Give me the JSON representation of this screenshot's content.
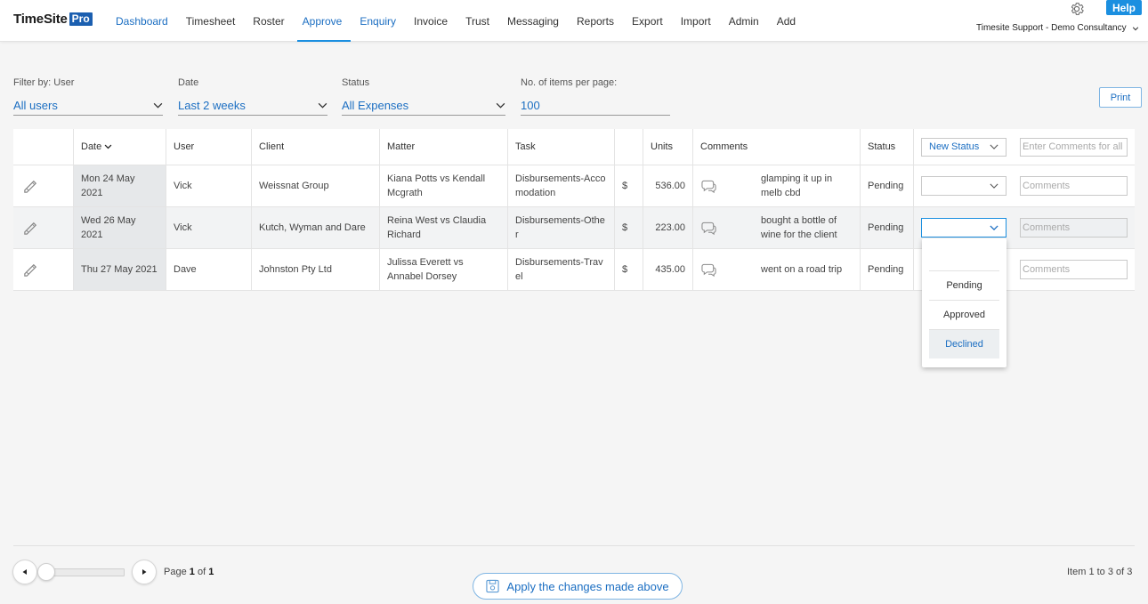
{
  "app": {
    "logo_main": "TimeSite",
    "logo_pro": "Pro",
    "help_label": "Help",
    "account_label": "Timesite Support - Demo Consultancy"
  },
  "nav": {
    "items": [
      {
        "label": "Dashboard"
      },
      {
        "label": "Timesheet"
      },
      {
        "label": "Roster"
      },
      {
        "label": "Approve"
      },
      {
        "label": "Enquiry"
      },
      {
        "label": "Invoice"
      },
      {
        "label": "Trust"
      },
      {
        "label": "Messaging"
      },
      {
        "label": "Reports"
      },
      {
        "label": "Export"
      },
      {
        "label": "Import"
      },
      {
        "label": "Admin"
      },
      {
        "label": "Add"
      }
    ],
    "active": "Approve"
  },
  "filters": {
    "user": {
      "label": "Filter by: User",
      "value": "All users"
    },
    "date": {
      "label": "Date",
      "value": "Last 2 weeks"
    },
    "status": {
      "label": "Status",
      "value": "All Expenses"
    },
    "per_page": {
      "label": "No. of items per page:",
      "value": "100"
    },
    "print_label": "Print"
  },
  "table": {
    "headers": {
      "date": "Date",
      "user": "User",
      "client": "Client",
      "matter": "Matter",
      "task": "Task",
      "units": "Units",
      "comments": "Comments",
      "status": "Status",
      "new_status": "New Status",
      "comments_all_placeholder": "Enter Comments for all"
    },
    "rows": [
      {
        "date": "Mon 24 May 2021",
        "user": "Vick",
        "client": "Weissnat Group",
        "matter": "Kiana Potts vs Kendall Mcgrath",
        "task": "Disbursements-Accomodation",
        "currency": "$",
        "units": "536.00",
        "comment": "glamping it up in melb cbd",
        "status": "Pending",
        "comment_placeholder": "Comments"
      },
      {
        "date": "Wed 26 May 2021",
        "user": "Vick",
        "client": "Kutch, Wyman and Dare",
        "matter": "Reina West vs Claudia Richard",
        "task": "Disbursements-Other",
        "currency": "$",
        "units": "223.00",
        "comment": "bought a bottle of wine for the client",
        "status": "Pending",
        "comment_placeholder": "Comments"
      },
      {
        "date": "Thu 27 May 2021",
        "user": "Dave",
        "client": "Johnston Pty Ltd",
        "matter": "Julissa Everett vs Annabel Dorsey",
        "task": "Disbursements-Travel",
        "currency": "$",
        "units": "435.00",
        "comment": "went on a road trip",
        "status": "Pending",
        "comment_placeholder": "Comments"
      }
    ]
  },
  "status_dropdown": {
    "options": [
      "",
      "Pending",
      "Approved",
      "Declined"
    ],
    "highlighted": "Declined"
  },
  "footer": {
    "page_prefix": "Page",
    "page_current": "1",
    "page_of": "of",
    "page_total": "1",
    "apply_label": "Apply the changes made above",
    "items_info": "Item 1 to 3 of 3"
  },
  "colors": {
    "accent": "#1b8fe0",
    "link": "#1b6ec2",
    "logo_badge": "#1b5fb0"
  }
}
